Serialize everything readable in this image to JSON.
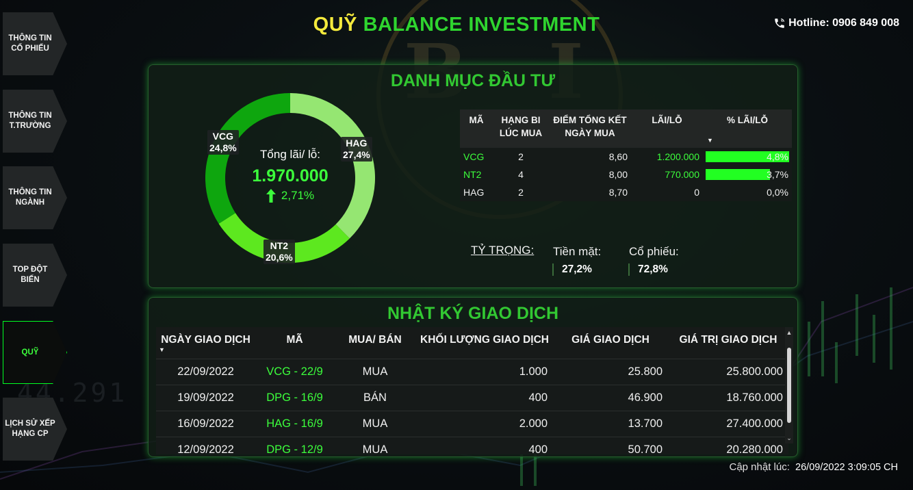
{
  "header": {
    "title_part1": "QUỸ",
    "title_part2": "BALANCE INVESTMENT",
    "hotline": "Hotline: 0906 849 008"
  },
  "sidebar": {
    "items": [
      {
        "label_line1": "THÔNG TIN",
        "label_line2": "CỔ PHIẾU"
      },
      {
        "label_line1": "THÔNG TIN",
        "label_line2": "T.TRƯỜNG"
      },
      {
        "label_line1": "THÔNG TIN",
        "label_line2": "NGÀNH"
      },
      {
        "label_line1": "TOP ĐỘT",
        "label_line2": "BIẾN"
      },
      {
        "label_line1": "QUỸ",
        "label_line2": ""
      },
      {
        "label_line1": "LỊCH SỬ XẾP",
        "label_line2": "HẠNG CP"
      }
    ],
    "active_index": 4
  },
  "portfolio": {
    "title": "DANH MỤC ĐẦU TƯ",
    "total_label": "Tổng lãi/ lỗ:",
    "total_value": "1.970.000",
    "total_pct": "2,71%",
    "donut": [
      {
        "name": "HAG",
        "pct_label": "27,4%",
        "value": 27.4,
        "color": "#95e672"
      },
      {
        "name": "NT2",
        "pct_label": "20,6%",
        "value": 20.6,
        "color": "#5de81f"
      },
      {
        "name": "VCG",
        "pct_label": "24,8%",
        "value": 24.8,
        "color": "#0ea60e"
      }
    ],
    "columns": [
      "MÃ",
      "HẠNG BI\nLÚC MUA",
      "ĐIỂM TỔNG KẾT\nNGÀY MUA",
      "LÃI/LỖ",
      "% LÃI/LỖ"
    ],
    "rows": [
      {
        "code": "VCG",
        "rank": "2",
        "score": "8,60",
        "pl": "1.200.000",
        "pl_positive": true,
        "pct": "4,8%",
        "pct_value": 4.8
      },
      {
        "code": "NT2",
        "rank": "4",
        "score": "8,00",
        "pl": "770.000",
        "pl_positive": true,
        "pct": "3,7%",
        "pct_value": 3.7
      },
      {
        "code": "HAG",
        "rank": "2",
        "score": "8,70",
        "pl": "0",
        "pl_positive": false,
        "pct": "0,0%",
        "pct_value": 0
      }
    ],
    "allocation": {
      "label": "TỶ TRỌNG:",
      "cash_label": "Tiền mặt:",
      "cash_value": "27,2%",
      "stock_label": "Cổ phiếu:",
      "stock_value": "72,8%"
    }
  },
  "journal": {
    "title": "NHẬT KÝ GIAO DỊCH",
    "columns": [
      "NGÀY GIAO DỊCH",
      "MÃ",
      "MUA/ BÁN",
      "KHỐI LƯỢNG GIAO DỊCH",
      "GIÁ GIAO DỊCH",
      "GIÁ TRỊ GIAO DỊCH"
    ],
    "rows": [
      {
        "date": "22/09/2022",
        "code": "VCG - 22/9",
        "side": "MUA",
        "volume": "1.000",
        "price": "25.800",
        "value": "25.800.000"
      },
      {
        "date": "19/09/2022",
        "code": "DPG - 16/9",
        "side": "BÁN",
        "volume": "400",
        "price": "46.900",
        "value": "18.760.000"
      },
      {
        "date": "16/09/2022",
        "code": "HAG - 16/9",
        "side": "MUA",
        "volume": "2.000",
        "price": "13.700",
        "value": "27.400.000"
      },
      {
        "date": "12/09/2022",
        "code": "DPG - 12/9",
        "side": "MUA",
        "volume": "400",
        "price": "50.700",
        "value": "20.280.000"
      }
    ]
  },
  "footer": {
    "updated_label": "Cập nhật lúc:",
    "updated_value": "26/09/2022 3:09:05 CH"
  },
  "background": {
    "watermark_letters": "B I",
    "ticker_number": "44.291"
  },
  "colors": {
    "accent_green": "#32c832",
    "bright_green": "#3cff3c",
    "title_yellow": "#f4ea3c"
  }
}
